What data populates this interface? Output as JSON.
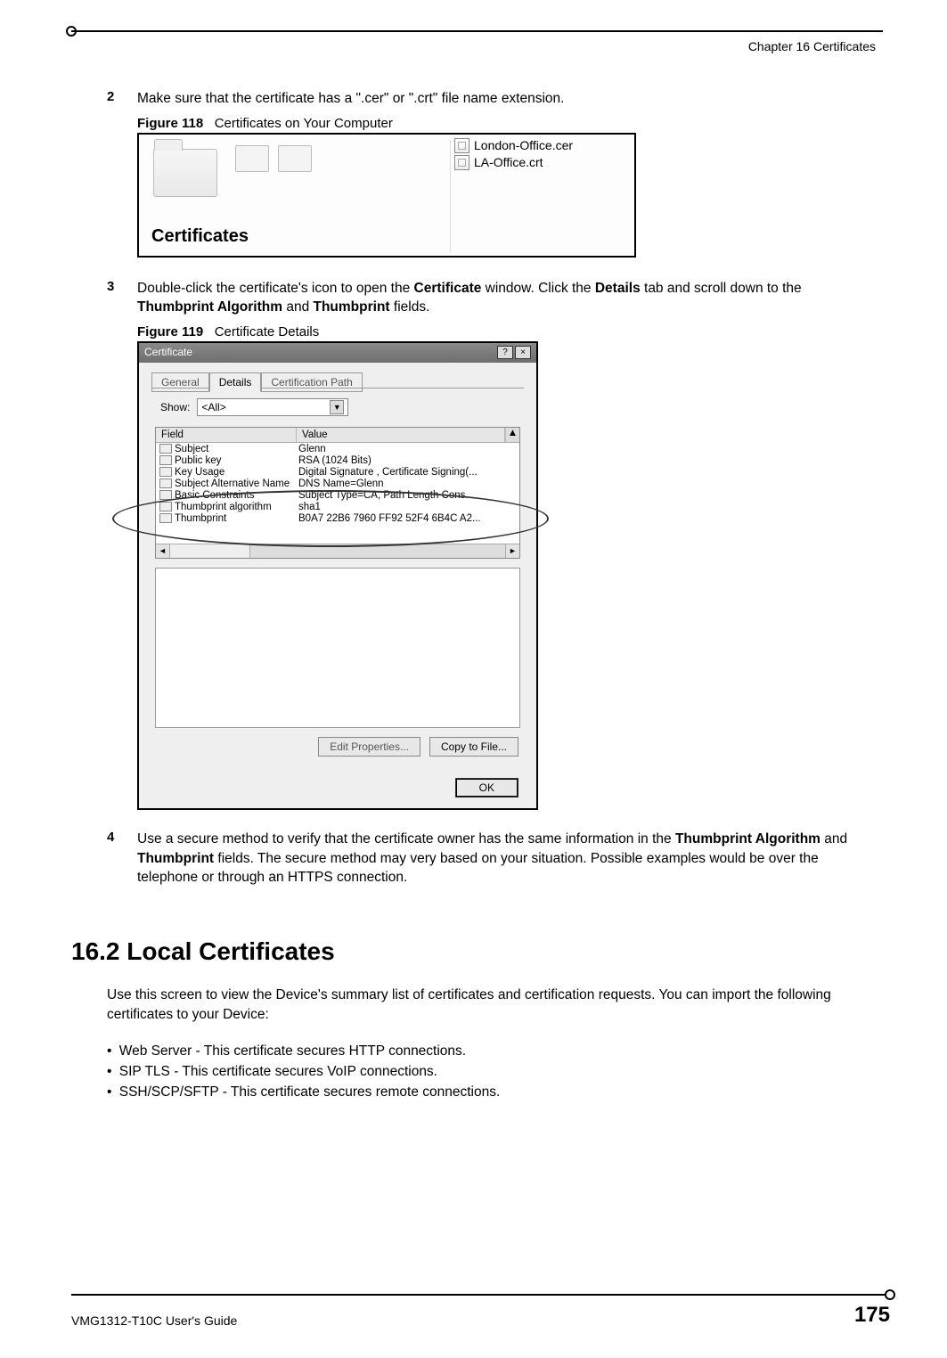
{
  "header": {
    "chapter": "Chapter 16 Certificates"
  },
  "steps": {
    "s2": {
      "num": "2",
      "text_a": "Make sure that the certificate has a \".cer\" or \".crt\" file name extension."
    },
    "s3": {
      "num": "3",
      "text_a": "Double-click the certificate's icon to open the ",
      "bold1": "Certificate",
      "text_b": " window. Click the ",
      "bold2": "Details",
      "text_c": " tab and scroll down to the ",
      "bold3": "Thumbprint Algorithm",
      "text_d": " and ",
      "bold4": "Thumbprint",
      "text_e": " fields."
    },
    "s4": {
      "num": "4",
      "text_a": "Use a secure method to verify that the certificate owner has the same information in the ",
      "bold1": "Thumbprint Algorithm",
      "text_b": " and ",
      "bold2": "Thumbprint",
      "text_c": " fields. The secure method may very based on your situation. Possible examples would be over the telephone or through an HTTPS connection."
    }
  },
  "figures": {
    "f118": {
      "label": "Figure 118",
      "caption": "Certificates on Your Computer",
      "folder_label": "Certificates",
      "files": [
        "London-Office.cer",
        "LA-Office.crt"
      ]
    },
    "f119": {
      "label": "Figure 119",
      "caption": "Certificate Details",
      "window_title": "Certificate",
      "tabs": [
        "General",
        "Details",
        "Certification Path"
      ],
      "show_label": "Show:",
      "show_value": "<All>",
      "columns": [
        "Field",
        "Value"
      ],
      "rows": [
        {
          "field": "Subject",
          "value": "Glenn"
        },
        {
          "field": "Public key",
          "value": "RSA (1024 Bits)"
        },
        {
          "field": "Key Usage",
          "value": "Digital Signature , Certificate Signing(..."
        },
        {
          "field": "Subject Alternative Name",
          "value": "DNS Name=Glenn"
        },
        {
          "field": "Basic Constraints",
          "value": "Subject Type=CA, Path Length Cons..."
        },
        {
          "field": "Thumbprint algorithm",
          "value": "sha1"
        },
        {
          "field": "Thumbprint",
          "value": "B0A7 22B6 7960 FF92 52F4 6B4C A2..."
        }
      ],
      "buttons": {
        "edit": "Edit Properties...",
        "copy": "Copy to File...",
        "ok": "OK"
      }
    }
  },
  "section": {
    "heading": "16.2  Local Certificates",
    "intro": "Use this screen to view the Device's summary list of certificates and certification requests. You can import the following certificates to your Device:",
    "bullets": [
      "Web Server - This certificate secures HTTP connections.",
      "SIP TLS - This certificate secures VoIP connections.",
      "SSH/SCP/SFTP - This certificate secures remote connections."
    ]
  },
  "footer": {
    "guide": "VMG1312-T10C User's Guide",
    "page": "175"
  }
}
